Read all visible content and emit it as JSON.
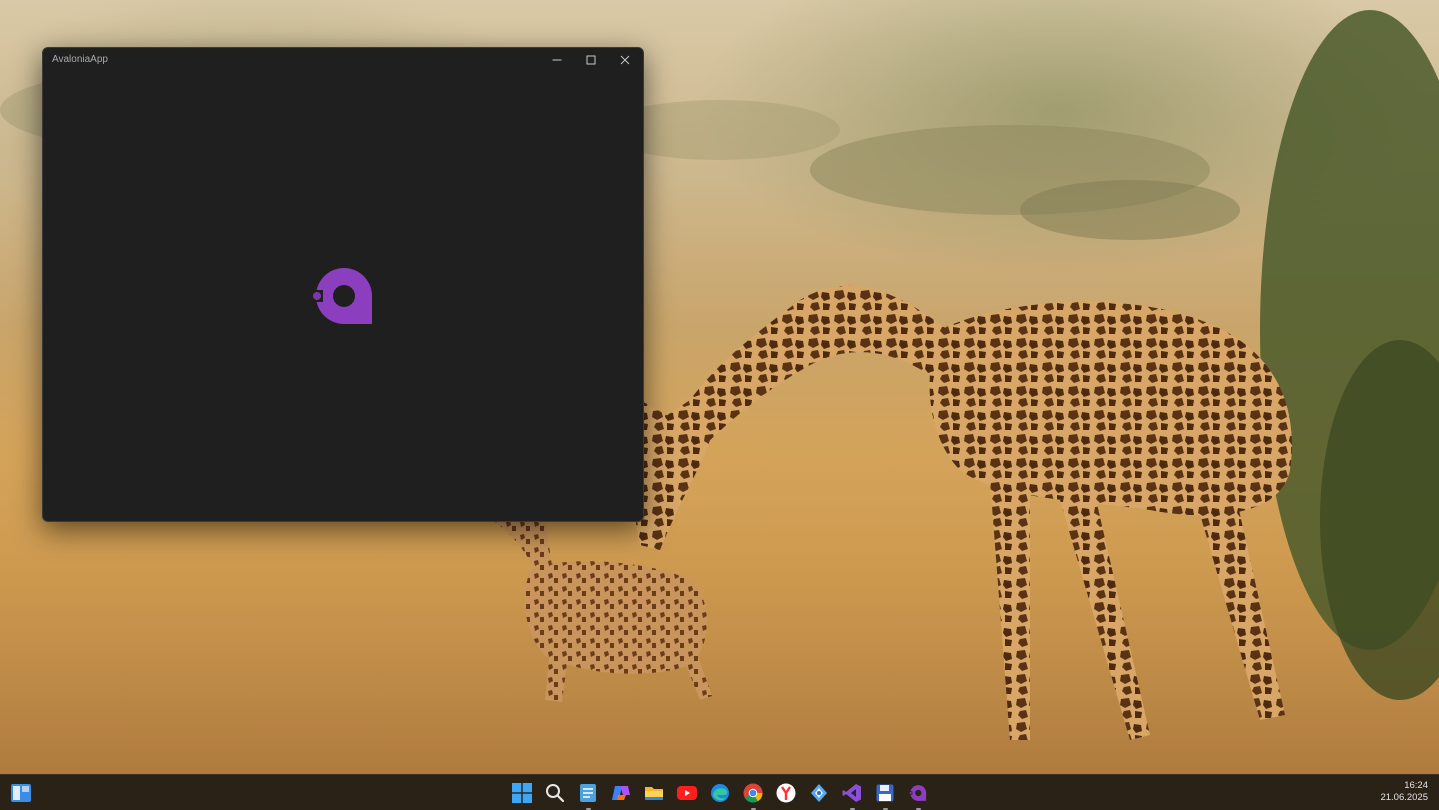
{
  "desktop": {
    "wallpaper": "giraffes-savanna"
  },
  "window": {
    "title": "AvaloniaApp",
    "buttons": {
      "minimize": "minimize-icon",
      "maximize": "maximize-icon",
      "close": "close-icon"
    },
    "logo_color": "#8b3fbf",
    "background": "#1f1f1f"
  },
  "taskbar": {
    "start_icon": "windows-start-icon",
    "apps": [
      {
        "name": "windows-start-icon",
        "running": false
      },
      {
        "name": "search-icon",
        "running": false
      },
      {
        "name": "notepad-icon",
        "running": true
      },
      {
        "name": "copilot-icon",
        "running": false
      },
      {
        "name": "file-explorer-icon",
        "running": false
      },
      {
        "name": "youtube-icon",
        "running": false
      },
      {
        "name": "edge-icon",
        "running": false
      },
      {
        "name": "chrome-icon",
        "running": true
      },
      {
        "name": "yandex-browser-icon",
        "running": false
      },
      {
        "name": "settings-app-icon",
        "running": false
      },
      {
        "name": "visual-studio-icon",
        "running": true
      },
      {
        "name": "floppy-save-icon",
        "running": true
      },
      {
        "name": "avalonia-app-icon",
        "running": true
      }
    ],
    "clock": {
      "time": "16:24",
      "date": "21.06.2025"
    }
  }
}
